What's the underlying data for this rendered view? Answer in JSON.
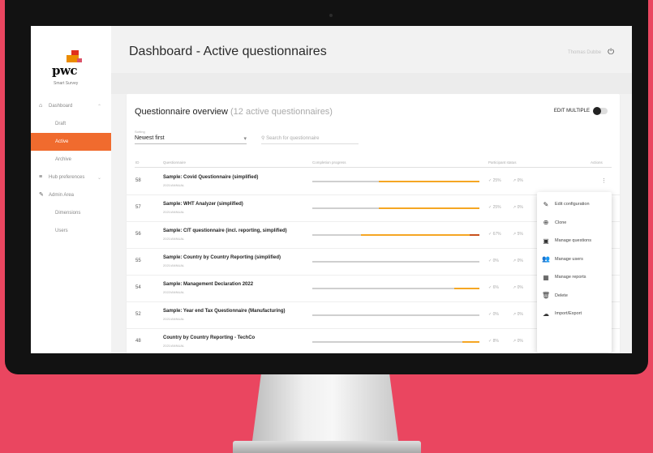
{
  "sidebar": {
    "logo_text": "pwc",
    "logo_subtitle": "Smart Survey",
    "items": [
      {
        "label": "Dashboard",
        "icon": "home-icon"
      },
      {
        "label": "Draft"
      },
      {
        "label": "Active"
      },
      {
        "label": "Archive"
      },
      {
        "label": "Hub preferences",
        "icon": "tune-icon"
      },
      {
        "label": "Admin Area",
        "icon": "wrench-icon"
      },
      {
        "label": "Dimensions"
      },
      {
        "label": "Users"
      }
    ]
  },
  "header": {
    "title": "Dashboard - Active questionnaires",
    "user_name": "Thomas Dubbe",
    "power_icon": "⏻"
  },
  "overview": {
    "title": "Questionnaire overview",
    "count_label": "(12 active questionnaires)",
    "edit_multiple_label": "EDIT MULTIPLE",
    "sort_label": "Sorting",
    "sort_value": "Newest first",
    "search_placeholder": "Search for questionnaire",
    "columns": {
      "id": "ID",
      "name": "Questionnaire",
      "progress": "Completion progress",
      "stats": "Participant status",
      "action": "Actions"
    }
  },
  "rows": [
    {
      "id": "58",
      "name": "Sample: Covid Questionnaire (simplified)",
      "type": "2021/ANNUAL",
      "progress": 0.6,
      "stat1": "✓ 25%",
      "stat2": "↗ 0%"
    },
    {
      "id": "57",
      "name": "Sample: WHT Analyzer (simplified)",
      "type": "2021/ANNUAL",
      "progress": 0.6,
      "stat1": "✓ 25%",
      "stat2": "↗ 0%"
    },
    {
      "id": "56",
      "name": "Sample: CIT questionnaire (incl. reporting, simplified)",
      "type": "2021/ANNUAL",
      "progress": 1.0,
      "stat1": "✓ 67%",
      "stat2": "↗ 5%"
    },
    {
      "id": "55",
      "name": "Sample: Country by Country Reporting (simplified)",
      "type": "2021/ANNUAL",
      "progress": 0.0,
      "stat1": "✓ 0%",
      "stat2": "↗ 0%"
    },
    {
      "id": "54",
      "name": "Sample: Management Declaration 2022",
      "type": "2022/ANNUAL",
      "progress": 0.15,
      "stat1": "✓ 6%",
      "stat2": "↗ 0%"
    },
    {
      "id": "52",
      "name": "Sample: Year end Tax Questionnaire (Manufacturing)",
      "type": "2021/ANNUAL",
      "progress": 0.0,
      "stat1": "✓ 0%",
      "stat2": "↗ 0%"
    },
    {
      "id": "48",
      "name": "Country by Country Reporting - TechCo",
      "type": "2021/ANNUAL",
      "progress": 0.1,
      "stat1": "✓ 8%",
      "stat2": "↗ 0%"
    }
  ],
  "context_menu": [
    {
      "label": "Edit configuration",
      "icon": "pencil-icon",
      "glyph": "✎"
    },
    {
      "label": "Clone",
      "icon": "copy-icon",
      "glyph": "⊕"
    },
    {
      "label": "Manage questions",
      "icon": "document-icon",
      "glyph": "▣"
    },
    {
      "label": "Manage users",
      "icon": "users-icon",
      "glyph": "👥"
    },
    {
      "label": "Manage reports",
      "icon": "table-icon",
      "glyph": "▦"
    },
    {
      "label": "Delete",
      "icon": "trash-icon",
      "glyph": "🗑"
    },
    {
      "label": "Import/Export",
      "icon": "cloud-icon",
      "glyph": "☁"
    }
  ],
  "colors": {
    "background": "#ea4660",
    "accent": "#f06b2e",
    "progress": "#f5a623"
  }
}
